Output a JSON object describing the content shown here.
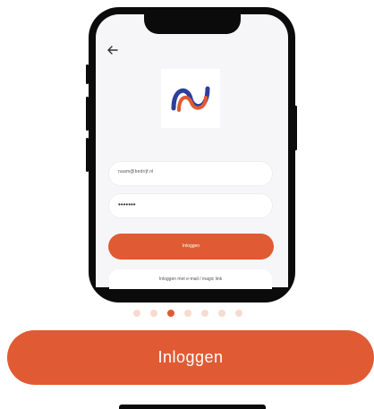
{
  "screen": {
    "back_icon": "arrow-left-icon",
    "logo_icon": "brand-wave-logo",
    "username_value": "naam@bedrijf.nl",
    "password_value": "•••••••",
    "login_small_label": "Inloggen",
    "alt_login_label": "Inloggen met e-mail / magic link"
  },
  "carousel": {
    "total": 7,
    "active_index": 2
  },
  "cta": {
    "label": "Inloggen"
  },
  "colors": {
    "accent": "#e05b33",
    "dot_inactive": "#f6dccf",
    "logo_blue": "#2b3f9c",
    "logo_orange": "#e05b33"
  }
}
